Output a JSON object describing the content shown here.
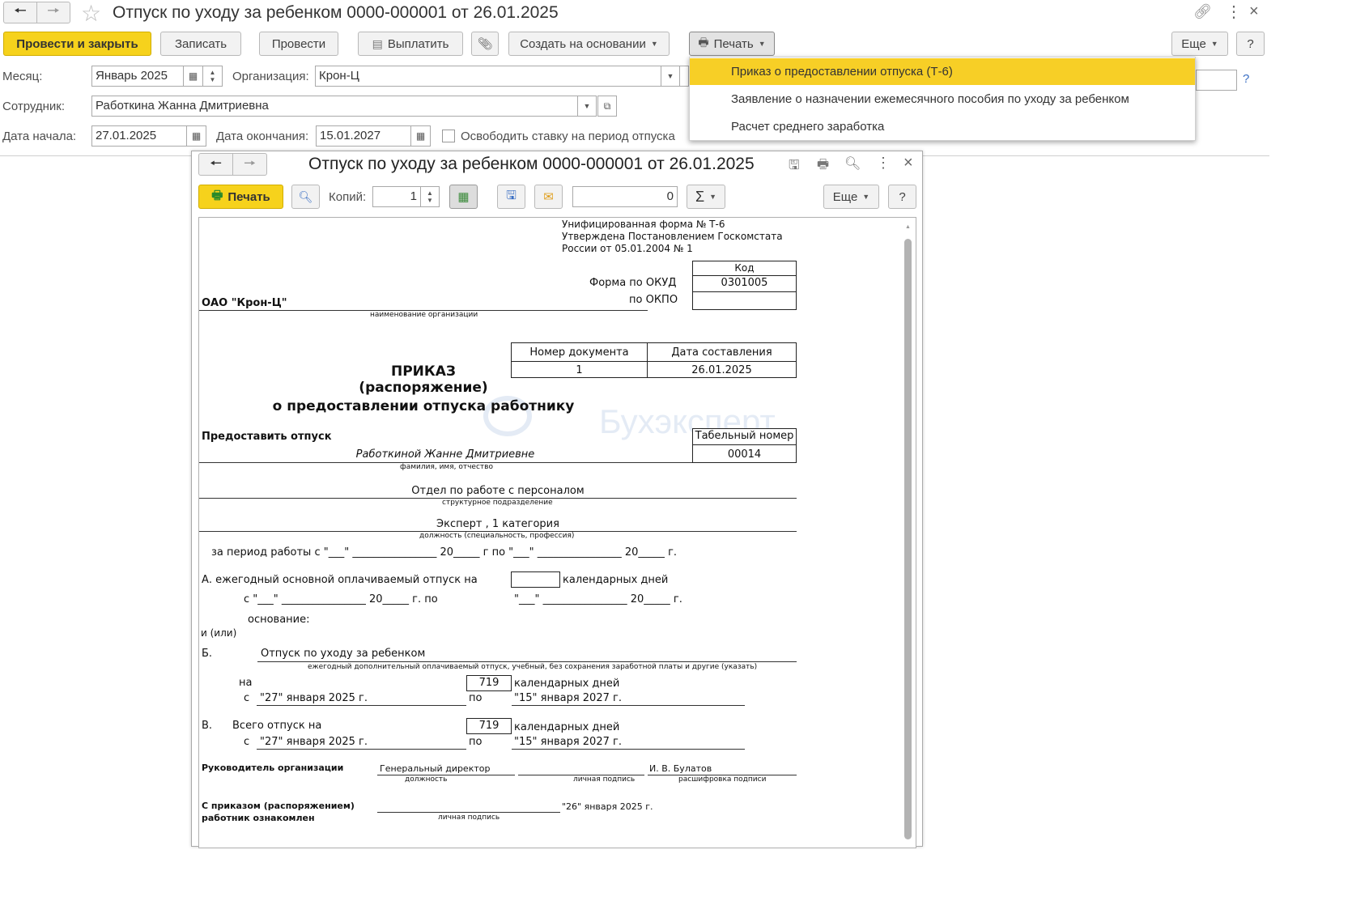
{
  "window": {
    "title": "Отпуск по уходу за ребенком 0000-000001 от 26.01.2025"
  },
  "toolbar": {
    "post_and_close": "Провести и закрыть",
    "save": "Записать",
    "post": "Провести",
    "pay": "Выплатить",
    "create_based_on": "Создать на основании",
    "print": "Печать",
    "more": "Еще",
    "help": "?"
  },
  "form": {
    "month_label": "Месяц:",
    "month_value": "Январь 2025",
    "org_label": "Организация:",
    "org_value": "Крон-Ц",
    "employee_label": "Сотрудник:",
    "employee_value": "Работкина Жанна Дмитриевна",
    "start_label": "Дата начала:",
    "start_value": "27.01.2025",
    "end_label": "Дата окончания:",
    "end_value": "15.01.2027",
    "release_label": "Освободить ставку на период отпуска",
    "hidden_help": "?"
  },
  "print_menu": {
    "items": [
      "Приказ о предоставлении отпуска (Т-6)",
      "Заявление о назначении ежемесячного пособия по уходу за ребенком",
      "Расчет среднего заработка"
    ]
  },
  "print_window": {
    "title": "Отпуск по уходу за ребенком 0000-000001 от 26.01.2025",
    "print": "Печать",
    "copies_label": "Копий:",
    "copies_value": "1",
    "sum_value": "0",
    "sigma": "Σ",
    "more": "Еще",
    "help": "?",
    "close": "×"
  },
  "doc": {
    "header_lines": [
      "Унифицированная форма № Т-6",
      "Утверждена Постановлением Госкомстата",
      "России от 05.01.2004 № 1"
    ],
    "code_label": "Код",
    "okud_label": "Форма по ОКУД",
    "okud_value": "0301005",
    "okpo_label": "по ОКПО",
    "org_name": "ОАО \"Крон-Ц\"",
    "org_caption": "наименование организации",
    "docnum_header": "Номер документа",
    "date_header": "Дата составления",
    "docnum_value": "1",
    "date_value": "26.01.2025",
    "title1": "ПРИКАЗ",
    "title2": "(распоряжение)",
    "title3": "о предоставлении отпуска работнику",
    "watermark": "Бухэксперт",
    "grant_label": "Предоставить отпуск",
    "tabnum_header": "Табельный номер",
    "tabnum_value": "00014",
    "employee_name": "Работкиной Жанне Дмитриевне",
    "fio_caption": "фамилия, имя, отчество",
    "department": "Отдел по работе с персоналом",
    "dept_caption": "структурное подразделение",
    "position": "Эксперт , 1 категория",
    "position_caption": "должность (специальность, профессия)",
    "period_line": "за период работы с  \"___\" ________________ 20_____ г по  \"___\" ________________ 20_____ г.",
    "a_label": "А. ежегодный основной оплачиваемый отпуск на",
    "cal_days": "календарных дней",
    "a_dates": "с  \"___\" ________________ 20_____ г.  по",
    "a_dates_to": "\"___\" ________________ 20_____ г.",
    "basis": "основание:",
    "and_or": "и (или)",
    "b_label": "Б.",
    "b_text": "Отпуск по уходу за ребенком",
    "b_caption": "ежегодный дополнительный оплачиваемый отпуск, учебный, без сохранения заработной платы и другие (указать)",
    "on_label": "на",
    "days_value": "719",
    "from_label": "с",
    "from_value": "\"27\" января 2025 г.",
    "to_label": "по",
    "to_value": "\"15\" января 2027 г.",
    "v_label": "В.",
    "v_text": "Всего отпуск на",
    "head_label": "Руководитель организации",
    "head_position": "Генеральный директор",
    "head_name": "И. В. Булатов",
    "cap_position": "должность",
    "cap_signature": "личная подпись",
    "cap_decode": "расшифровка подписи",
    "ack1": "С приказом (распоряжением)",
    "ack2": "работник  ознакомлен",
    "ack_date": "\"26\" января 2025 г."
  }
}
